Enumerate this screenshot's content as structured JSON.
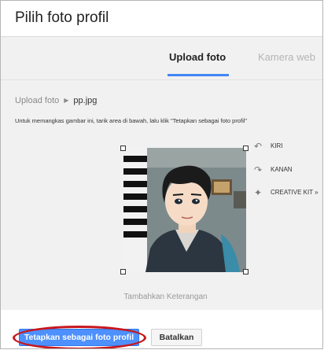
{
  "dialog": {
    "title": "Pilih foto profil"
  },
  "tabs": [
    {
      "label": "Upload foto",
      "active": true
    },
    {
      "label": "Kamera web",
      "active": false
    }
  ],
  "breadcrumb": {
    "root": "Upload foto",
    "separator_icon": "chevron-right-icon",
    "file": "pp.jpg"
  },
  "instruction": "Untuk memangkas gambar ini, tarik area di bawah, lalu klik \"Tetapkan sebagai foto profil\"",
  "tools": [
    {
      "label": "KIRI",
      "icon": "rotate-left-icon"
    },
    {
      "label": "KANAN",
      "icon": "rotate-right-icon"
    },
    {
      "label": "CREATIVE KIT »",
      "icon": "sparkle-icon"
    }
  ],
  "caption": "Tambahkan Keterangan",
  "buttons": {
    "primary": "Tetapkan sebagai foto profil",
    "secondary": "Batalkan"
  },
  "colors": {
    "accent": "#4285f4",
    "primary_button": "#4d90fe",
    "highlight_ring": "#c8161d",
    "panel_background": "#f1f1f1"
  }
}
